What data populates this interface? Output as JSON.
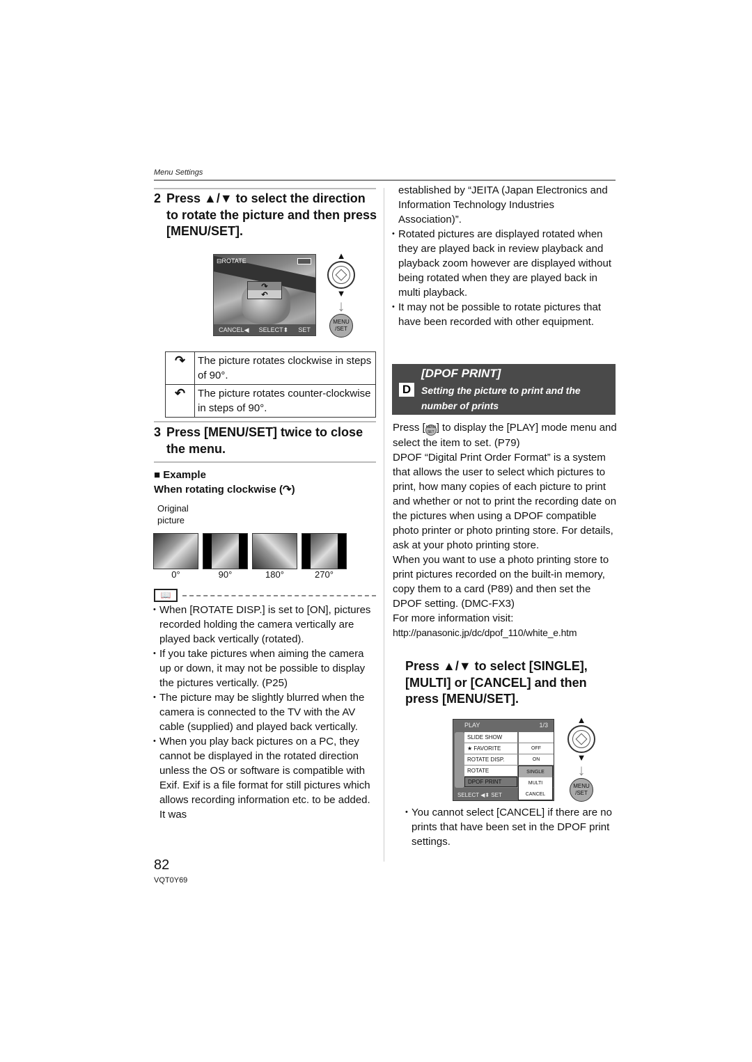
{
  "header": {
    "section_label": "Menu Settings"
  },
  "left": {
    "step2": {
      "number": "2",
      "text": "Press ▲/▼ to select the direction to rotate the picture and then press [MENU/SET]."
    },
    "rotate_screen": {
      "title": "ROTATE",
      "options": [
        "↷",
        "↶"
      ],
      "selected_option": 0,
      "footer": {
        "cancel": "CANCEL◀",
        "select": "SELECT⬍",
        "set": "SET"
      }
    },
    "controls": {
      "up": "▲",
      "down": "▼",
      "arrow": "↓",
      "menu_line1": "MENU",
      "menu_line2": "/SET"
    },
    "rotation_table": [
      {
        "icon": "clockwise-arrow",
        "glyph": "↷",
        "text": "The picture rotates clockwise in steps of 90°."
      },
      {
        "icon": "counter-clockwise-arrow",
        "glyph": "↶",
        "text": "The picture rotates counter-clockwise in steps of 90°."
      }
    ],
    "step3": {
      "number": "3",
      "text": "Press [MENU/SET] twice to close the menu."
    },
    "example": {
      "heading": "■ Example",
      "subheading": "When rotating clockwise (",
      "subheading_end": ")",
      "original_label_1": "Original",
      "original_label_2": "picture",
      "angles": [
        "0°",
        "90°",
        "180°",
        "270°"
      ]
    },
    "notes": [
      "When [ROTATE DISP.] is set to [ON], pictures recorded holding the camera vertically are played back vertically (rotated).",
      "If you take pictures when aiming the camera up or down, it may not be possible to display the pictures vertically. (P25)",
      "The picture may be slightly blurred when the camera is connected to the TV with the AV cable (supplied) and played back vertically.",
      "When you play back pictures on a PC, they cannot be displayed in the rotated direction unless the OS or software is compatible with Exif. Exif is a file format for still pictures which allows recording information etc. to be added. It was"
    ]
  },
  "right": {
    "continued_text": "established by “JEITA (Japan Electronics and Information Technology Industries Association)”.",
    "notes": [
      "Rotated pictures are displayed rotated when they are played back in review playback and playback zoom however are displayed without being rotated when they are played back in multi playback.",
      "It may not be possible to rotate pictures that have been recorded with other equipment."
    ],
    "dpof_banner": {
      "title": "[DPOF PRINT]",
      "subtitle": "Setting the picture to print and the number of prints"
    },
    "intro_pre": "Press [",
    "intro_post": "] to display the [PLAY] mode menu and select the item to set. (P79)",
    "menu_icon_line1": "MENU",
    "menu_icon_line2": "SET",
    "description": "DPOF “Digital Print Order Format” is a system that allows the user to select which pictures to print, how many copies of each picture to print and whether or not to print the recording date on the pictures when using a DPOF compatible photo printer or photo printing store. For details, ask at your photo printing store.",
    "built_in_memory": "When you want to use a photo printing store to print pictures recorded on the built-in memory, copy them to a card (P89) and then set the DPOF setting. (DMC-FX3)",
    "more_info": "For more information visit:",
    "url": "http://panasonic.jp/dc/dpof_110/white_e.htm",
    "step": "Press ▲/▼ to select [SINGLE], [MULTI] or [CANCEL] and then press [MENU/SET].",
    "play_menu": {
      "title": "PLAY",
      "page": "1/3",
      "items": [
        {
          "label": "SLIDE SHOW",
          "value": ""
        },
        {
          "label": "★ FAVORITE",
          "value": "OFF"
        },
        {
          "label": "ROTATE DISP.",
          "value": "ON"
        },
        {
          "label": "ROTATE",
          "value": ""
        },
        {
          "label": "DPOF PRINT",
          "value": ""
        }
      ],
      "submenu": [
        "SINGLE",
        "MULTI",
        "CANCEL"
      ],
      "submenu_selected": 0,
      "footer": "SELECT ◀⬍ SET"
    },
    "final_note": "You cannot select [CANCEL] if there are no prints that have been set in the DPOF print settings."
  },
  "footer": {
    "page_number": "82",
    "model_code": "VQT0Y69"
  }
}
